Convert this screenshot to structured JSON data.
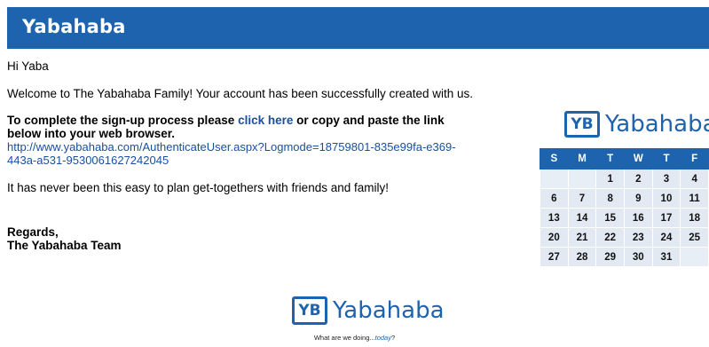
{
  "header": {
    "title": "Yabahaba"
  },
  "email": {
    "greeting": "Hi Yaba",
    "welcome": "Welcome to The Yabahaba Family! Your account has been successfully created with us.",
    "instr_prefix": "To complete the sign-up process please",
    "instr_link": "click here",
    "instr_suffix": "or copy and paste the link",
    "instr_line2": "below into your web browser.",
    "url_line1": "http://www.yabahaba.com/AuthenticateUser.aspx?Logmode=18759801-835e99fa-e369-",
    "url_line2": "443a-a531-9530061627242045",
    "tagline_text": "It has never been this easy to plan get-togethers with friends and family!",
    "regards": "Regards,",
    "signature": "The Yabahaba Team"
  },
  "calendar_logo": {
    "mark": "YB",
    "word": "Yabahaba"
  },
  "calendar": {
    "headers": [
      "S",
      "M",
      "T",
      "W",
      "T",
      "F"
    ],
    "rows": [
      [
        "",
        "",
        "1",
        "2",
        "3",
        "4"
      ],
      [
        "6",
        "7",
        "8",
        "9",
        "10",
        "11"
      ],
      [
        "13",
        "14",
        "15",
        "16",
        "17",
        "18"
      ],
      [
        "20",
        "21",
        "22",
        "23",
        "24",
        "25"
      ],
      [
        "27",
        "28",
        "29",
        "30",
        "31",
        ""
      ]
    ]
  },
  "footer": {
    "logo_mark": "YB",
    "logo_word": "Yabahaba",
    "tagline_prefix": "What are we doing...",
    "tagline_emph": "today",
    "tagline_suffix": "?"
  },
  "colors": {
    "brand": "#1e63ad",
    "link": "#1a4fa0",
    "calendar_cell": "#e2e9f2"
  }
}
